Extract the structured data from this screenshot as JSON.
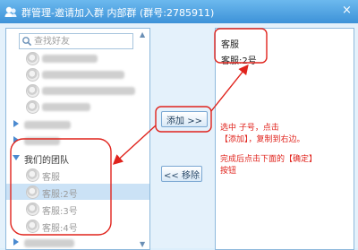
{
  "window": {
    "title": "群管理-邀请加入群  内部群 (群号:2785911)",
    "close_symbol": "×"
  },
  "left_panel": {
    "search_placeholder": "查找好友",
    "group": {
      "name": "我们的团队",
      "members": [
        "客服",
        "客服:2号",
        "客服:3号",
        "客服:4号"
      ]
    }
  },
  "buttons": {
    "add": "添加 >>",
    "remove": "<< 移除"
  },
  "right_panel": {
    "selected": [
      "客服",
      "客服:2号"
    ]
  },
  "annotations": {
    "line1": "选中 子号，点击",
    "line2": "【添加】，复制到右边。",
    "line3": "完成后点击下面的【确定】",
    "line4": "按钮",
    "color": "#e0231c"
  }
}
